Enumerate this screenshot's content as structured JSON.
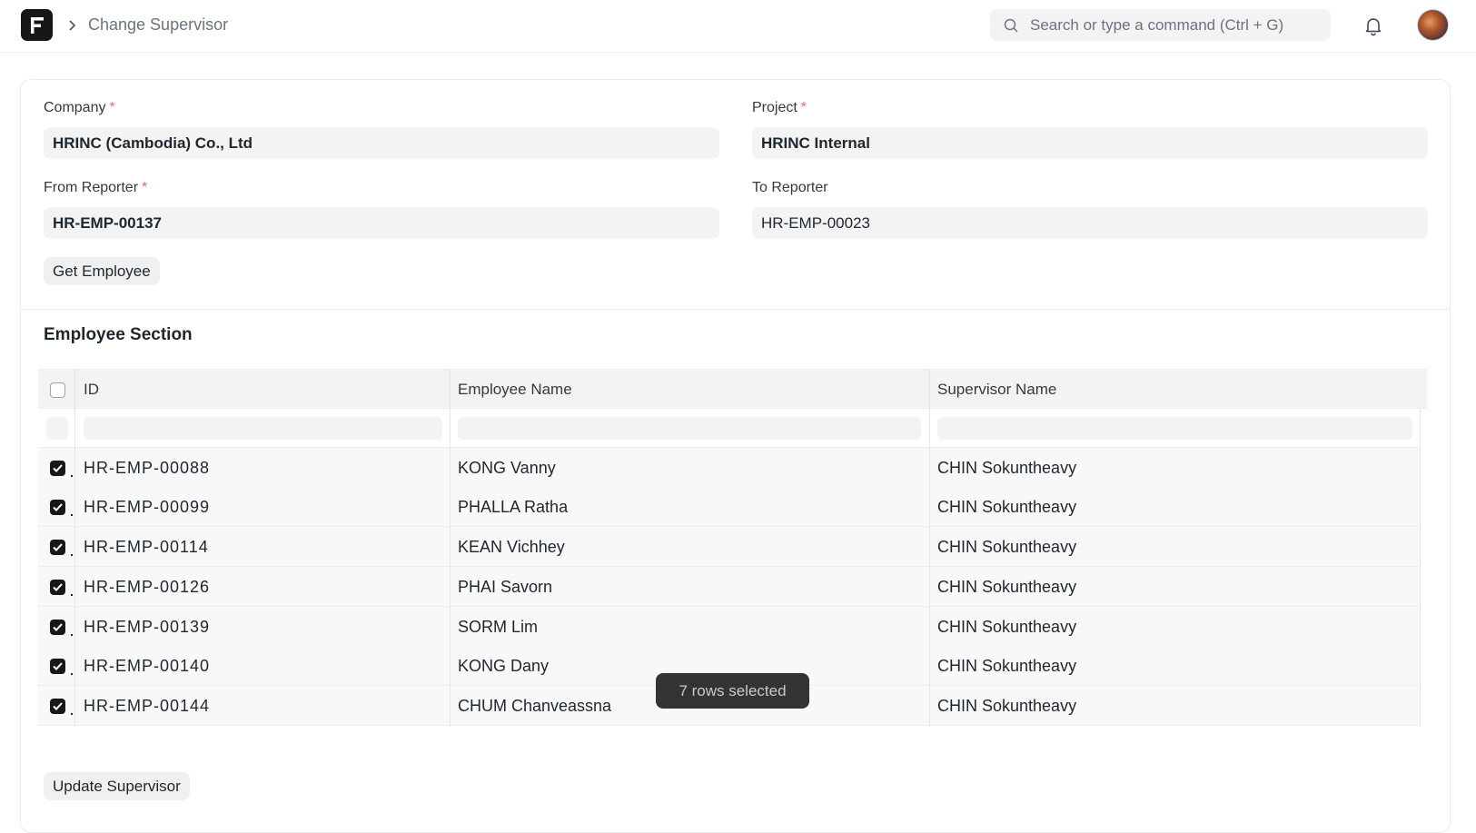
{
  "navbar": {
    "logo_letter": "F",
    "breadcrumb": "Change Supervisor",
    "search_placeholder": "Search or type a command (Ctrl + G)"
  },
  "form": {
    "company": {
      "label": "Company",
      "required": "*",
      "value": "HRINC (Cambodia) Co., Ltd"
    },
    "project": {
      "label": "Project",
      "required": "*",
      "value": "HRINC Internal"
    },
    "from_reporter": {
      "label": "From Reporter",
      "required": "*",
      "value": "HR-EMP-00137"
    },
    "to_reporter": {
      "label": "To Reporter",
      "value": "HR-EMP-00023"
    },
    "get_employee_label": "Get Employee"
  },
  "section": {
    "title": "Employee Section",
    "columns": [
      "ID",
      "Employee Name",
      "Supervisor Name"
    ],
    "rows": [
      {
        "id": "HR-EMP-00088",
        "name": "KONG Vanny",
        "supervisor": "CHIN Sokuntheavy",
        "checked": true
      },
      {
        "id": "HR-EMP-00099",
        "name": "PHALLA Ratha",
        "supervisor": "CHIN Sokuntheavy",
        "checked": true
      },
      {
        "id": "HR-EMP-00114",
        "name": "KEAN Vichhey",
        "supervisor": "CHIN Sokuntheavy",
        "checked": true
      },
      {
        "id": "HR-EMP-00126",
        "name": "PHAI Savorn",
        "supervisor": "CHIN Sokuntheavy",
        "checked": true
      },
      {
        "id": "HR-EMP-00139",
        "name": "SORM Lim",
        "supervisor": "CHIN Sokuntheavy",
        "checked": true
      },
      {
        "id": "HR-EMP-00140",
        "name": "KONG Dany",
        "supervisor": "CHIN Sokuntheavy",
        "checked": true
      },
      {
        "id": "HR-EMP-00144",
        "name": "CHUM Chanveassna",
        "supervisor": "CHIN Sokuntheavy",
        "checked": true
      }
    ],
    "toast": "7 rows selected"
  },
  "footer": {
    "update_label": "Update Supervisor"
  },
  "colors": {
    "accent": "#171717",
    "required": "#e86c6c",
    "toast_bg": "#333333"
  }
}
